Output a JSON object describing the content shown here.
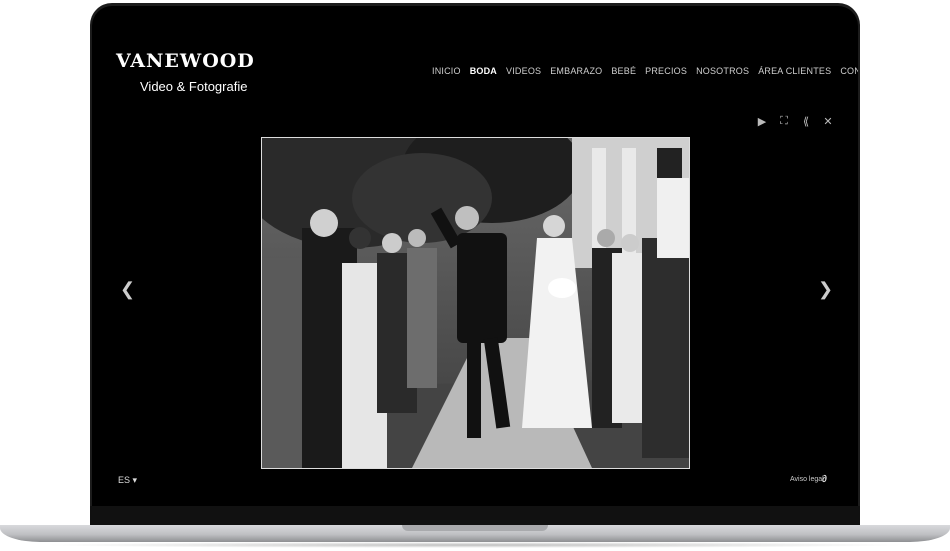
{
  "brand": {
    "name": "VANEWOOD",
    "tagline": "Video & Fotografie"
  },
  "nav": {
    "items": [
      {
        "label": "INICIO",
        "active": false
      },
      {
        "label": "BODA",
        "active": true
      },
      {
        "label": "VIDEOS",
        "active": false
      },
      {
        "label": "EMBARAZO",
        "active": false
      },
      {
        "label": "BEBÉ",
        "active": false
      },
      {
        "label": "PRECIOS",
        "active": false
      },
      {
        "label": "NOSOTROS",
        "active": false
      },
      {
        "label": "ÁREA CLIENTES",
        "active": false
      },
      {
        "label": "CONTACTO",
        "active": false
      }
    ],
    "social": [
      "share-icon",
      "facebook-icon",
      "instagram-icon"
    ]
  },
  "gallery": {
    "toolbar": [
      "play-icon",
      "fullscreen-icon",
      "share-icon",
      "close-icon"
    ],
    "prev_icon": "chevron-left-icon",
    "next_icon": "chevron-right-icon"
  },
  "footer": {
    "language": "ES",
    "legal_label": "Aviso legal"
  },
  "colors": {
    "background": "#000000",
    "text": "#ffffff",
    "nav_text": "#cfcfcf"
  }
}
